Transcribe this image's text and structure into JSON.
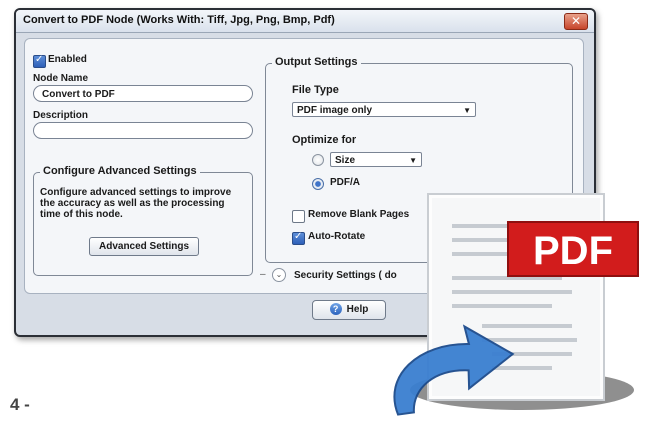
{
  "window": {
    "title": "Convert to PDF Node    (Works With: Tiff, Jpg, Png, Bmp, Pdf)",
    "close_glyph": "✕"
  },
  "left": {
    "enabled_label": "Enabled",
    "enabled_checked": true,
    "node_name_label": "Node Name",
    "node_name_value": "Convert to PDF",
    "description_label": "Description",
    "description_value": "",
    "advanced_group_title": "Configure Advanced Settings",
    "advanced_text": "Configure advanced settings to improve the accuracy as well as the processing time of this node.",
    "advanced_button": "Advanced Settings"
  },
  "output": {
    "group_title": "Output Settings",
    "file_type_label": "File Type",
    "file_type_value": "PDF image only",
    "optimize_label": "Optimize for",
    "size_option": "Size",
    "pdfa_option": "PDF/A",
    "selected_option": "PDF/A",
    "remove_blank_label": "Remove Blank Pages",
    "remove_blank_checked": false,
    "auto_rotate_label": "Auto-Rotate",
    "auto_rotate_checked": true
  },
  "security": {
    "label": "Security Settings ( do"
  },
  "footer": {
    "help_label": "Help"
  },
  "overlay": {
    "pdf_badge": "PDF"
  },
  "page": {
    "number": "4 -"
  },
  "icons": [
    "checkbox-icon",
    "dropdown-arrow-icon",
    "radio-icon",
    "expand-chevron-icon",
    "help-icon",
    "pdf-document-icon",
    "curved-arrow-icon",
    "close-icon"
  ],
  "colors": {
    "accent": "#2d5fb8",
    "pdf_red": "#d21c1c",
    "window_bg": "#d7dde6",
    "arrow_blue": "#3a7fd0"
  }
}
